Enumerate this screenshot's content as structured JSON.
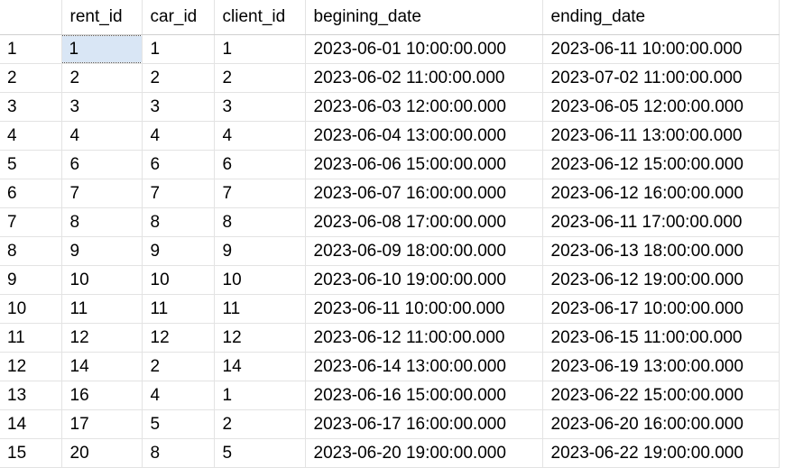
{
  "columns": [
    "rent_id",
    "car_id",
    "client_id",
    "begining_date",
    "ending_date"
  ],
  "rows": [
    {
      "n": "1",
      "rent_id": "1",
      "car_id": "1",
      "client_id": "1",
      "begining_date": "2023-06-01 10:00:00.000",
      "ending_date": "2023-06-11 10:00:00.000"
    },
    {
      "n": "2",
      "rent_id": "2",
      "car_id": "2",
      "client_id": "2",
      "begining_date": "2023-06-02 11:00:00.000",
      "ending_date": "2023-07-02 11:00:00.000"
    },
    {
      "n": "3",
      "rent_id": "3",
      "car_id": "3",
      "client_id": "3",
      "begining_date": "2023-06-03 12:00:00.000",
      "ending_date": "2023-06-05 12:00:00.000"
    },
    {
      "n": "4",
      "rent_id": "4",
      "car_id": "4",
      "client_id": "4",
      "begining_date": "2023-06-04 13:00:00.000",
      "ending_date": "2023-06-11 13:00:00.000"
    },
    {
      "n": "5",
      "rent_id": "6",
      "car_id": "6",
      "client_id": "6",
      "begining_date": "2023-06-06 15:00:00.000",
      "ending_date": "2023-06-12 15:00:00.000"
    },
    {
      "n": "6",
      "rent_id": "7",
      "car_id": "7",
      "client_id": "7",
      "begining_date": "2023-06-07 16:00:00.000",
      "ending_date": "2023-06-12 16:00:00.000"
    },
    {
      "n": "7",
      "rent_id": "8",
      "car_id": "8",
      "client_id": "8",
      "begining_date": "2023-06-08 17:00:00.000",
      "ending_date": "2023-06-11 17:00:00.000"
    },
    {
      "n": "8",
      "rent_id": "9",
      "car_id": "9",
      "client_id": "9",
      "begining_date": "2023-06-09 18:00:00.000",
      "ending_date": "2023-06-13 18:00:00.000"
    },
    {
      "n": "9",
      "rent_id": "10",
      "car_id": "10",
      "client_id": "10",
      "begining_date": "2023-06-10 19:00:00.000",
      "ending_date": "2023-06-12 19:00:00.000"
    },
    {
      "n": "10",
      "rent_id": "11",
      "car_id": "11",
      "client_id": "11",
      "begining_date": "2023-06-11 10:00:00.000",
      "ending_date": "2023-06-17 10:00:00.000"
    },
    {
      "n": "11",
      "rent_id": "12",
      "car_id": "12",
      "client_id": "12",
      "begining_date": "2023-06-12 11:00:00.000",
      "ending_date": "2023-06-15 11:00:00.000"
    },
    {
      "n": "12",
      "rent_id": "14",
      "car_id": "2",
      "client_id": "14",
      "begining_date": "2023-06-14 13:00:00.000",
      "ending_date": "2023-06-19 13:00:00.000"
    },
    {
      "n": "13",
      "rent_id": "16",
      "car_id": "4",
      "client_id": "1",
      "begining_date": "2023-06-16 15:00:00.000",
      "ending_date": "2023-06-22 15:00:00.000"
    },
    {
      "n": "14",
      "rent_id": "17",
      "car_id": "5",
      "client_id": "2",
      "begining_date": "2023-06-17 16:00:00.000",
      "ending_date": "2023-06-20 16:00:00.000"
    },
    {
      "n": "15",
      "rent_id": "20",
      "car_id": "8",
      "client_id": "5",
      "begining_date": "2023-06-20 19:00:00.000",
      "ending_date": "2023-06-22 19:00:00.000"
    }
  ]
}
